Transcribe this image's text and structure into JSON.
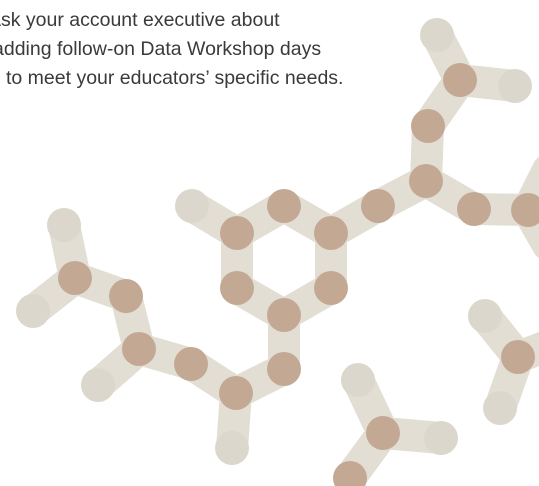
{
  "blurb": {
    "line1": "Ask your account executive about",
    "line2": "adding follow-on Data Workshop days",
    "line3": "to meet your educators’ specific needs."
  },
  "colors": {
    "background": "#ffffff",
    "text": "#3a3a3a",
    "bond": "#e2ded4",
    "bond_tip": "#dcd7cc",
    "atom": "#c3a994"
  }
}
